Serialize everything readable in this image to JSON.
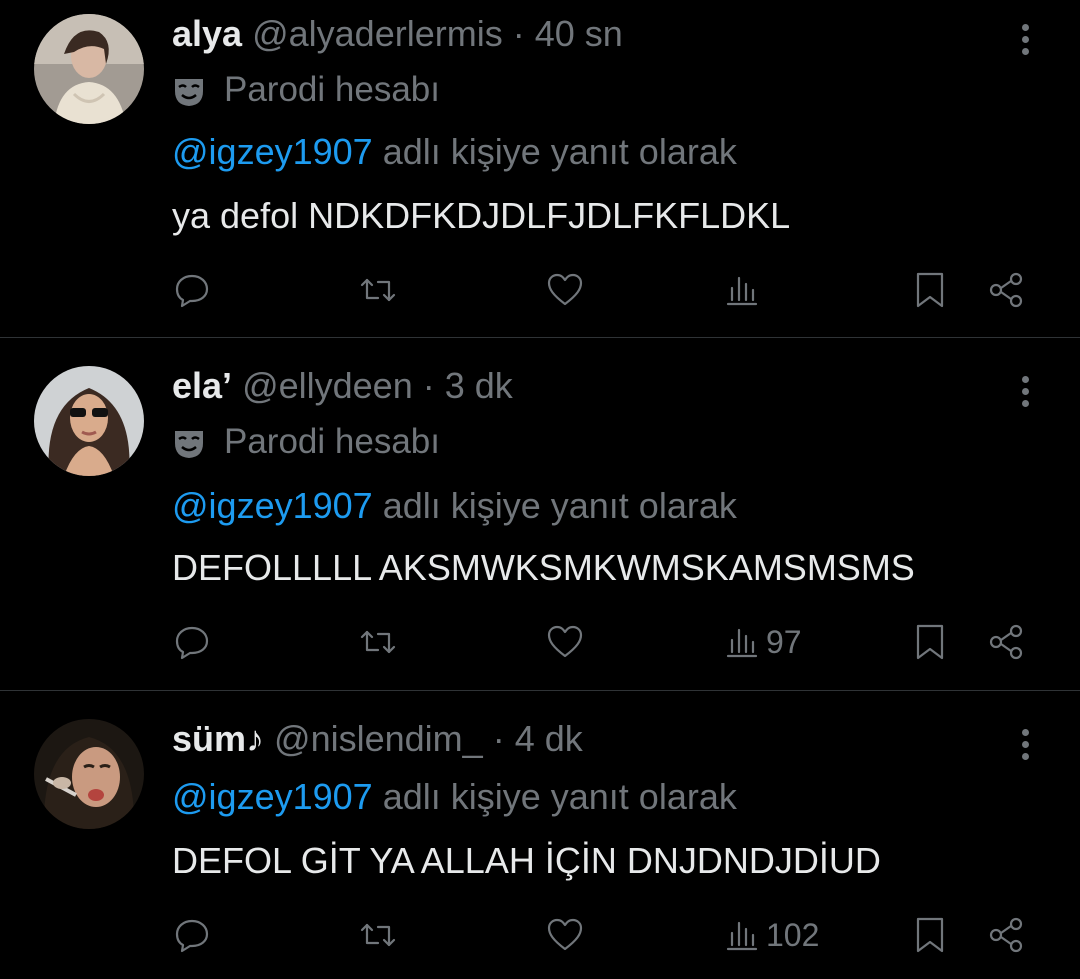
{
  "tweets": [
    {
      "name": "alya",
      "handle": "@alyaderlermis",
      "time": "· 40 sn",
      "label": "Parodi hesabı",
      "mention": "@igzey1907",
      "reply_suffix": "adlı kişiye yanıt olarak",
      "text": "ya defol NDKDFKDJDLFJDLFKFLDKL",
      "views": ""
    },
    {
      "name": "ela’",
      "handle": "@ellydeen",
      "time": "· 3 dk",
      "label": "Parodi hesabı",
      "mention": "@igzey1907",
      "reply_suffix": "adlı kişiye yanıt olarak",
      "text": "DEFOLLLLL AKSMWKSMKWMSKAMSMSMS",
      "views": "97"
    },
    {
      "name": "süm♪",
      "handle": "@nislendim_",
      "time": "· 4 dk",
      "mention": "@igzey1907",
      "reply_suffix": "adlı kişiye yanıt olarak",
      "text": "DEFOL GİT YA ALLAH İÇİN DNJDNDJDİUD",
      "views": "102"
    }
  ],
  "icons": {
    "reply": "reply-icon",
    "retweet": "retweet-icon",
    "like": "heart-icon",
    "views": "views-icon",
    "bookmark": "bookmark-icon",
    "share": "share-icon",
    "parody": "mask-icon",
    "more": "more-icon"
  },
  "colors": {
    "background": "#000000",
    "text": "#e7e9ea",
    "muted": "#71767b",
    "mention": "#1d9bf0",
    "divider": "#2f3336"
  }
}
